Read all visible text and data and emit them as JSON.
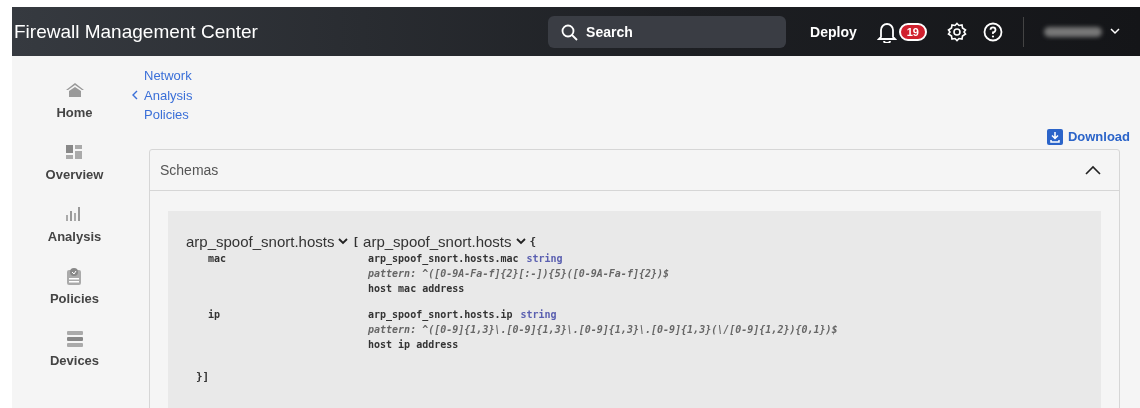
{
  "header": {
    "title": "Firewall Management Center",
    "search": {
      "placeholder": "Search"
    },
    "deploy": "Deploy",
    "notification_count": "19"
  },
  "sidebar": {
    "items": [
      {
        "label": "Home"
      },
      {
        "label": "Overview"
      },
      {
        "label": "Analysis"
      },
      {
        "label": "Policies"
      },
      {
        "label": "Devices"
      }
    ]
  },
  "breadcrumb": {
    "back": "Network Analysis Policies"
  },
  "download": "Download",
  "panel": {
    "title": "Schemas",
    "expanded": true,
    "schema": {
      "name": "arp_spoof_snort.hosts",
      "open_bracket": "[",
      "type_name": "arp_spoof_snort.hosts",
      "open_brace": "{",
      "close": "}]",
      "fields": [
        {
          "name": "mac",
          "path": "arp_spoof_snort.hosts.mac",
          "type": "string",
          "pattern": "pattern: ^([0-9A-Fa-f]{2}[:-]){5}([0-9A-Fa-f]{2})$",
          "description": "host mac address"
        },
        {
          "name": "ip",
          "path": "arp_spoof_snort.hosts.ip",
          "type": "string",
          "pattern": "pattern: ^([0-9]{1,3}\\.[0-9]{1,3}\\.[0-9]{1,3}\\.[0-9]{1,3}(\\/[0-9]{1,2}){0,1})$",
          "description": "host ip address"
        }
      ]
    }
  }
}
